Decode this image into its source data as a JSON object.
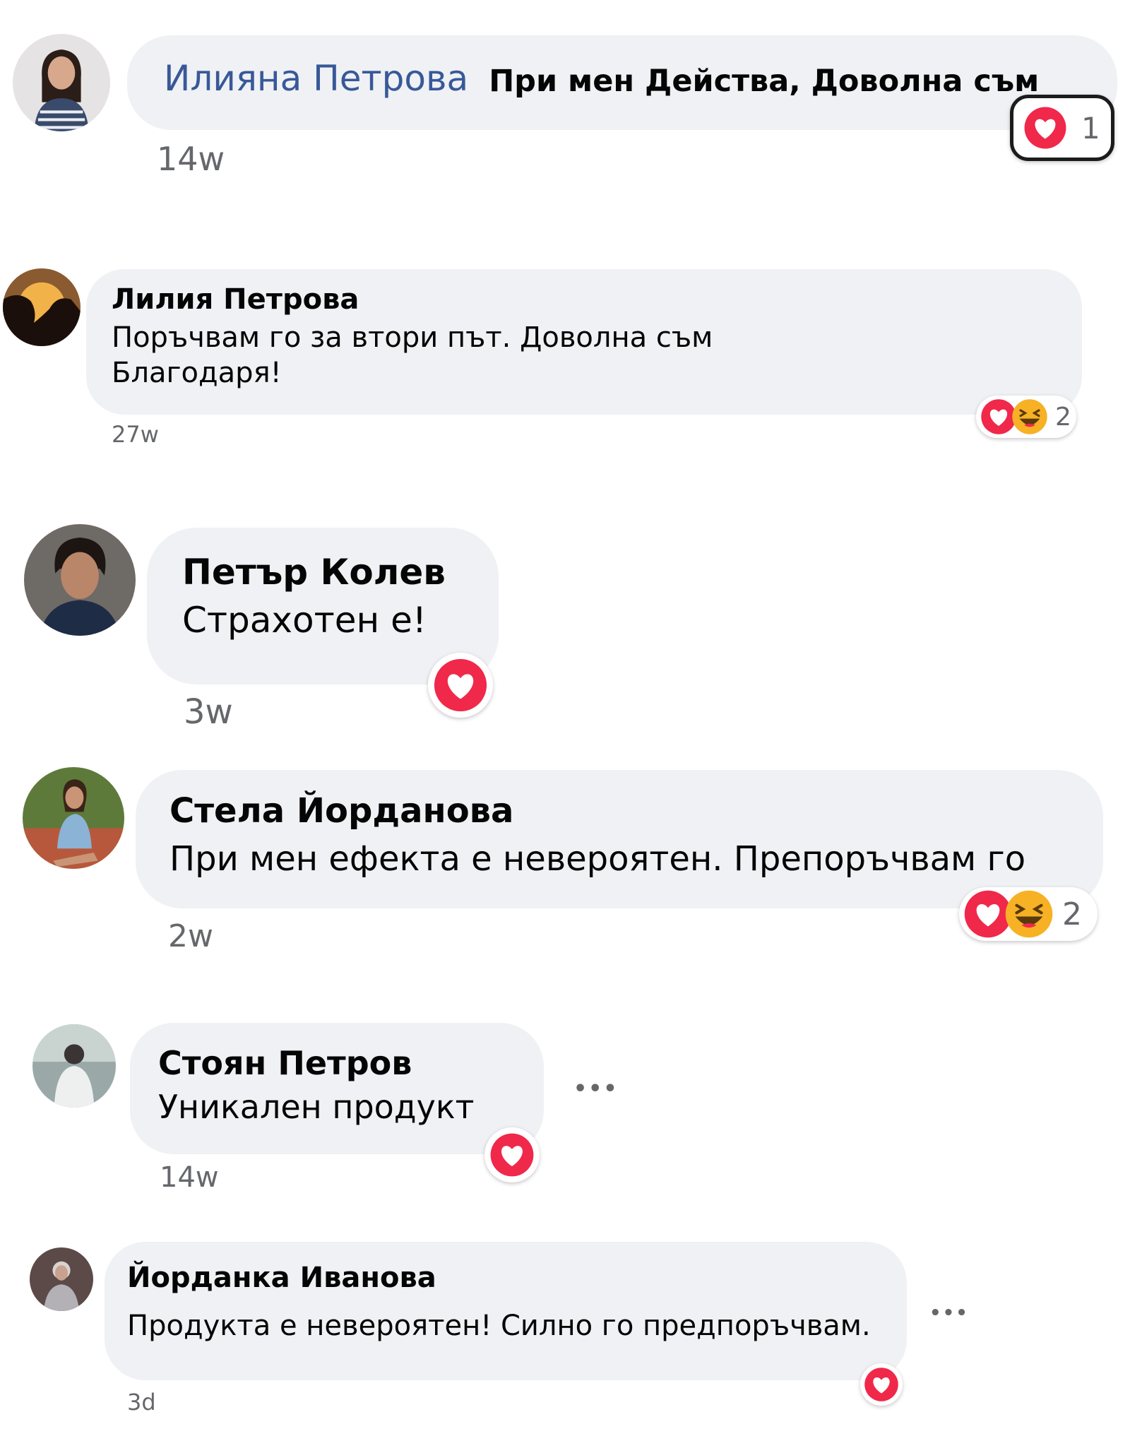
{
  "colors": {
    "bubble": "#eff1f4",
    "name_link": "#385898",
    "love": "#f0284a",
    "haha": "#f7b125",
    "meta": "#65676b"
  },
  "comments": [
    {
      "author": "Илияна Петрова",
      "text": "При мен Действа, Доволна съм",
      "time": "14w",
      "reactions": [
        "love"
      ],
      "reaction_count": "1",
      "avatar": "woman-striped-shirt-photo"
    },
    {
      "author": "Лилия Петрова",
      "text_line1": "Поръчвам го за втори път. Доволна съм",
      "text_line2": "Благодаря!",
      "time": "27w",
      "reactions": [
        "love",
        "haha"
      ],
      "reaction_count": "2",
      "avatar": "couple-silhouette-photo"
    },
    {
      "author": "Петър Колев",
      "text": "Страхотен е!",
      "time": "3w",
      "reactions": [
        "love"
      ],
      "avatar": "man-dark-hair-photo"
    },
    {
      "author": "Стела Йорданова",
      "text": "При мен ефекта е невероятен. Препоръчвам го",
      "time": "2w",
      "reactions": [
        "love",
        "haha"
      ],
      "reaction_count": "2",
      "avatar": "woman-sitting-outdoors-photo"
    },
    {
      "author": "Стоян Петров",
      "text": "Уникален продукт",
      "time": "14w",
      "reactions": [
        "love"
      ],
      "more": "•••",
      "avatar": "man-back-view-photo"
    },
    {
      "author": "Йорданка Иванова",
      "text": "Продукта е невероятен! Силно го предпоръчвам.",
      "time": "3d",
      "reactions": [
        "love"
      ],
      "more": "•••",
      "avatar": "elderly-woman-photo"
    }
  ]
}
